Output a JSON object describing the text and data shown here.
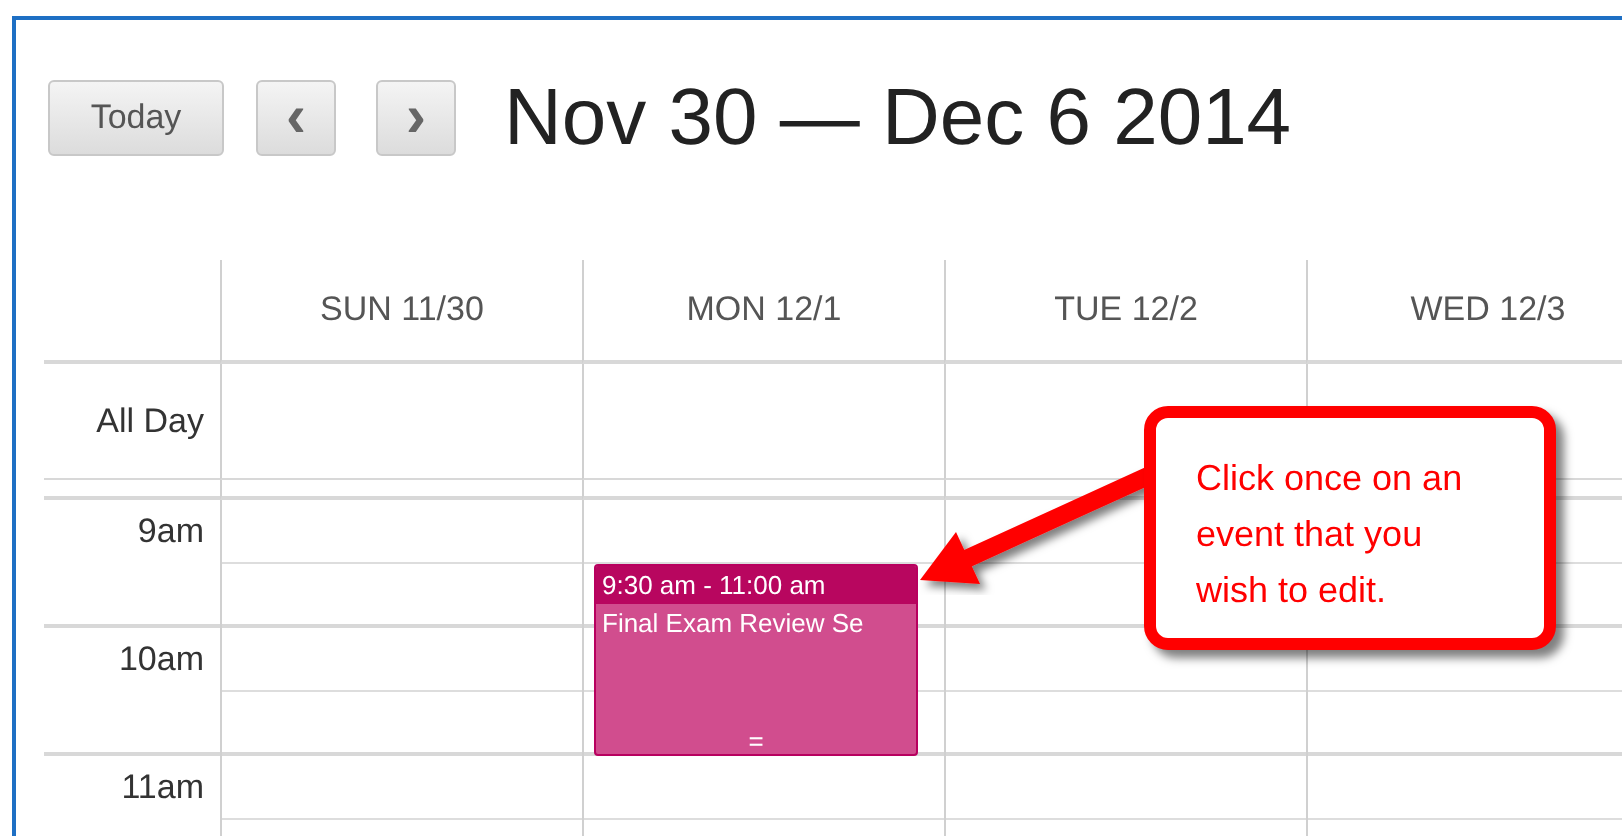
{
  "toolbar": {
    "today_button": "Today",
    "prev_button": "‹",
    "next_button": "›",
    "title": "Nov 30 — Dec 6 2014"
  },
  "days": [
    {
      "label": "SUN 11/30"
    },
    {
      "label": "MON 12/1",
      "events": [
        {
          "time": "9:30 am - 11:00 am",
          "title": "Final Exam Review Se",
          "handle": "="
        }
      ]
    },
    {
      "label": "TUE 12/2"
    },
    {
      "label": "WED 12/3"
    }
  ],
  "all_day_label": "All Day",
  "hours": [
    "9am",
    "10am",
    "11am"
  ],
  "callout": {
    "text": "Click once on an event that you wish to edit."
  }
}
